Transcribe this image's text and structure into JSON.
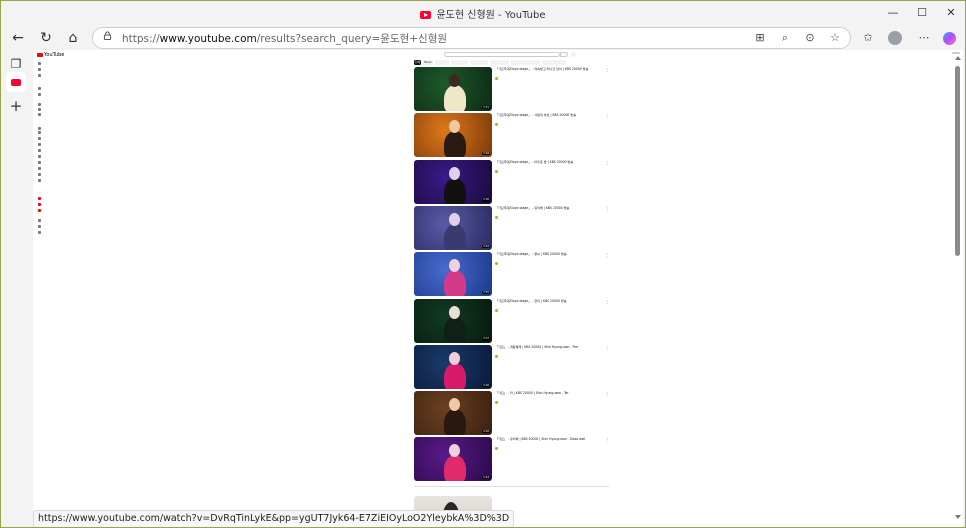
{
  "window": {
    "title": "윤도현 신형원 - YouTube",
    "controls": {
      "minimize": "—",
      "maximize": "☐",
      "close": "✕"
    }
  },
  "toolbar": {
    "back": "←",
    "refresh": "↻",
    "home": "⌂",
    "url_prefix": "https://",
    "url_host": "www.youtube.com",
    "url_rest": "/results?search_query=윤도현+신형원"
  },
  "sidepanel": {
    "new_tab": "+"
  },
  "youtube": {
    "logo": "YouTube",
    "search_placeholder": "",
    "signin": "",
    "filters_label": "",
    "chips": [
      "전체",
      "Music",
      "",
      "",
      "",
      "",
      "",
      ""
    ],
    "sidebar_items": [
      "",
      "",
      "",
      "",
      "",
      "",
      "",
      "",
      "",
      "",
      "",
      "",
      "",
      "",
      "",
      "",
      "",
      "",
      "",
      "",
      "",
      "",
      "",
      ""
    ],
    "results": [
      {
        "title": "「가요무대/Gayo stage」 - 약속받고 떠나간 남아 | KBS 20000 방송",
        "duration": "3:51",
        "theme": "green"
      },
      {
        "title": "「가요무대/Gayo stage」 - 사랑의 바보 | KBS 20000 방송",
        "duration": "3:48",
        "theme": "orange"
      },
      {
        "title": "「가요무대/Gayo stage」 - 어두운 밤 | KBS 20000 방송",
        "duration": "3:30",
        "theme": "purple"
      },
      {
        "title": "「가요무대/Gayo stage」 - 유리벽 | KBS 20000 방송",
        "duration": "3:42",
        "theme": "blue"
      },
      {
        "title": "「가요무대/Gayo stage」 - 불씨 | KBS 20000 방송",
        "duration": "3:55",
        "theme": "blue2"
      },
      {
        "title": "「가요무대/Gayo stage」 - 장미 | KBS 20000 방송",
        "duration": "3:37",
        "theme": "darkgreen"
      },
      {
        "title": "「가요」 - 개똥벌레 | KBS 20000 | Shin Hyung-won - Fire",
        "duration": "3:20",
        "theme": "navy"
      },
      {
        "title": "「가요」 - 터 | KBS 20000 | Shin Hyung-won - Ter",
        "duration": "4:02",
        "theme": "brown"
      },
      {
        "title": "「가요」 - 유리벽 | KBS 20000 | Shin Hyung-won - Glass wall",
        "duration": "3:44",
        "theme": "violet"
      }
    ],
    "shelf_title": "",
    "shelf_result_title": ""
  },
  "status_url": "https://www.youtube.com/watch?v=DvRqTinLykE&pp=ygUT7Jyk64-E7ZiEIOyLoO2YleybkA%3D%3D"
}
